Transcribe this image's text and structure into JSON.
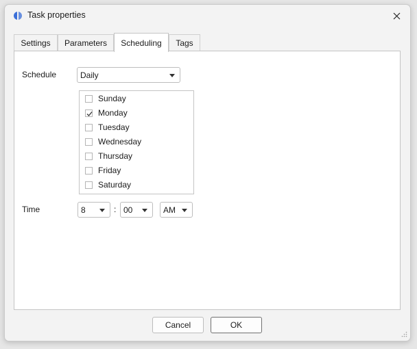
{
  "window": {
    "title": "Task properties"
  },
  "tabs": [
    {
      "label": "Settings",
      "active": false
    },
    {
      "label": "Parameters",
      "active": false
    },
    {
      "label": "Scheduling",
      "active": true
    },
    {
      "label": "Tags",
      "active": false
    }
  ],
  "schedule": {
    "label": "Schedule",
    "value": "Daily"
  },
  "days": [
    {
      "label": "Sunday",
      "checked": false
    },
    {
      "label": "Monday",
      "checked": true
    },
    {
      "label": "Tuesday",
      "checked": false
    },
    {
      "label": "Wednesday",
      "checked": false
    },
    {
      "label": "Thursday",
      "checked": false
    },
    {
      "label": "Friday",
      "checked": false
    },
    {
      "label": "Saturday",
      "checked": false
    }
  ],
  "time": {
    "label": "Time",
    "hour": "8",
    "separator": ":",
    "minute": "00",
    "ampm": "AM"
  },
  "buttons": {
    "cancel": "Cancel",
    "ok": "OK"
  },
  "colors": {
    "app_icon": "#3b6fd8",
    "dialog_bg": "#f3f3f3",
    "panel_bg": "#ffffff"
  }
}
